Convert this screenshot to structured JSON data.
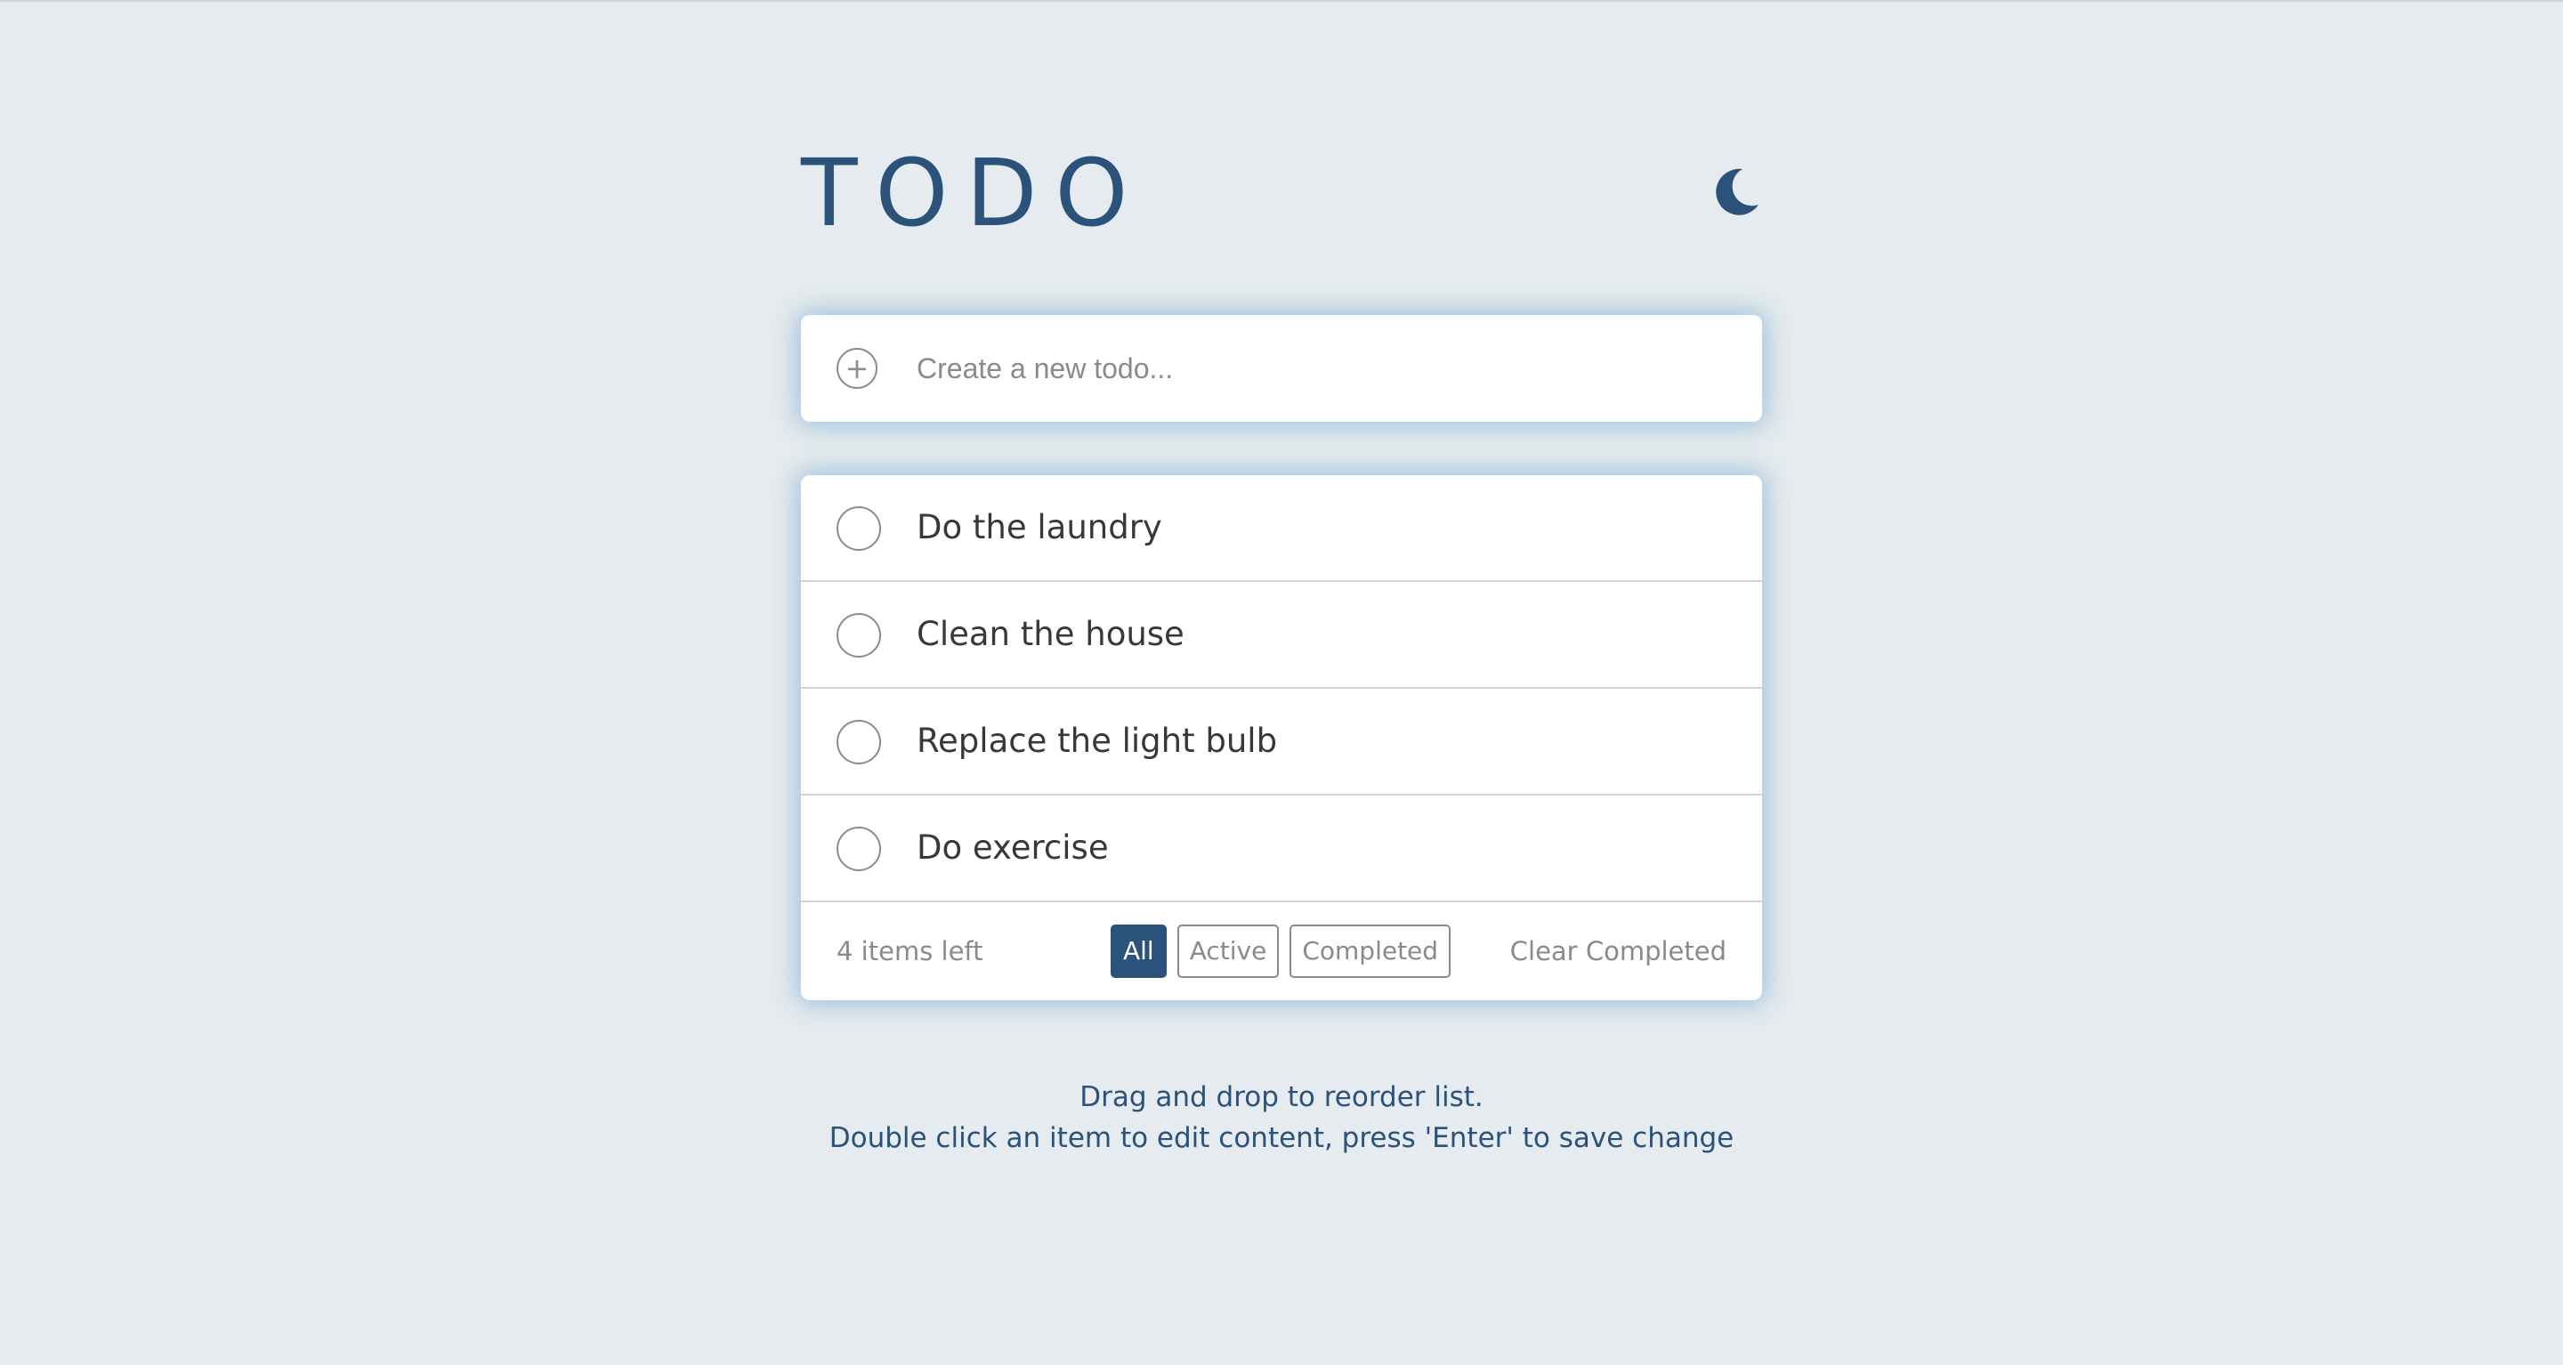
{
  "header": {
    "title": "TODO",
    "theme_toggle_icon": "moon-icon"
  },
  "new_todo": {
    "icon": "plus-icon",
    "plus_glyph": "+",
    "placeholder": "Create a new todo...",
    "value": ""
  },
  "todos": [
    {
      "text": "Do the laundry",
      "completed": false
    },
    {
      "text": "Clean the house",
      "completed": false
    },
    {
      "text": "Replace the light bulb",
      "completed": false
    },
    {
      "text": "Do exercise",
      "completed": false
    }
  ],
  "footer": {
    "items_left": "4 items left",
    "filters": {
      "all": "All",
      "active": "Active",
      "completed": "Completed"
    },
    "selected_filter": "All",
    "clear_completed": "Clear Completed"
  },
  "hints": {
    "line1": "Drag and drop to reorder list.",
    "line2": "Double click an item to edit content, press 'Enter' to save change"
  },
  "colors": {
    "background": "#e5ebee",
    "accent": "#2a527a",
    "card": "#ffffff",
    "muted_text": "#8a8a8a",
    "divider": "#d4d4d4"
  }
}
